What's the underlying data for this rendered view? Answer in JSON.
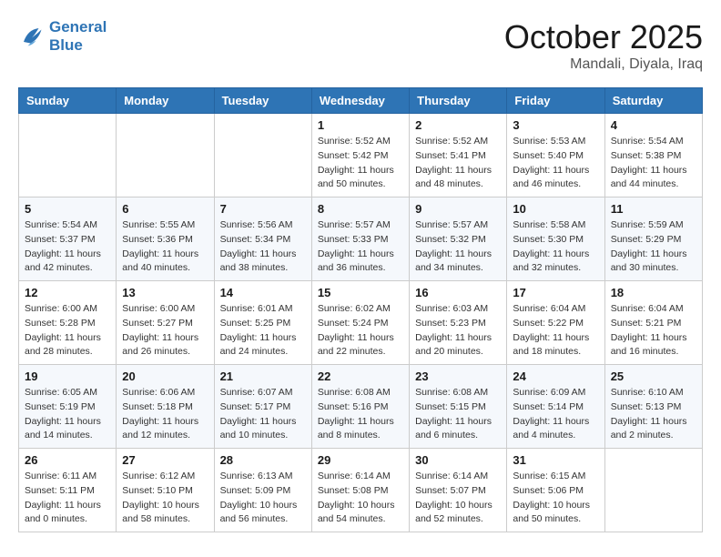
{
  "header": {
    "logo_line1": "General",
    "logo_line2": "Blue",
    "month": "October 2025",
    "location": "Mandali, Diyala, Iraq"
  },
  "weekdays": [
    "Sunday",
    "Monday",
    "Tuesday",
    "Wednesday",
    "Thursday",
    "Friday",
    "Saturday"
  ],
  "weeks": [
    [
      {
        "day": "",
        "sunrise": "",
        "sunset": "",
        "daylight": ""
      },
      {
        "day": "",
        "sunrise": "",
        "sunset": "",
        "daylight": ""
      },
      {
        "day": "",
        "sunrise": "",
        "sunset": "",
        "daylight": ""
      },
      {
        "day": "1",
        "sunrise": "Sunrise: 5:52 AM",
        "sunset": "Sunset: 5:42 PM",
        "daylight": "Daylight: 11 hours and 50 minutes."
      },
      {
        "day": "2",
        "sunrise": "Sunrise: 5:52 AM",
        "sunset": "Sunset: 5:41 PM",
        "daylight": "Daylight: 11 hours and 48 minutes."
      },
      {
        "day": "3",
        "sunrise": "Sunrise: 5:53 AM",
        "sunset": "Sunset: 5:40 PM",
        "daylight": "Daylight: 11 hours and 46 minutes."
      },
      {
        "day": "4",
        "sunrise": "Sunrise: 5:54 AM",
        "sunset": "Sunset: 5:38 PM",
        "daylight": "Daylight: 11 hours and 44 minutes."
      }
    ],
    [
      {
        "day": "5",
        "sunrise": "Sunrise: 5:54 AM",
        "sunset": "Sunset: 5:37 PM",
        "daylight": "Daylight: 11 hours and 42 minutes."
      },
      {
        "day": "6",
        "sunrise": "Sunrise: 5:55 AM",
        "sunset": "Sunset: 5:36 PM",
        "daylight": "Daylight: 11 hours and 40 minutes."
      },
      {
        "day": "7",
        "sunrise": "Sunrise: 5:56 AM",
        "sunset": "Sunset: 5:34 PM",
        "daylight": "Daylight: 11 hours and 38 minutes."
      },
      {
        "day": "8",
        "sunrise": "Sunrise: 5:57 AM",
        "sunset": "Sunset: 5:33 PM",
        "daylight": "Daylight: 11 hours and 36 minutes."
      },
      {
        "day": "9",
        "sunrise": "Sunrise: 5:57 AM",
        "sunset": "Sunset: 5:32 PM",
        "daylight": "Daylight: 11 hours and 34 minutes."
      },
      {
        "day": "10",
        "sunrise": "Sunrise: 5:58 AM",
        "sunset": "Sunset: 5:30 PM",
        "daylight": "Daylight: 11 hours and 32 minutes."
      },
      {
        "day": "11",
        "sunrise": "Sunrise: 5:59 AM",
        "sunset": "Sunset: 5:29 PM",
        "daylight": "Daylight: 11 hours and 30 minutes."
      }
    ],
    [
      {
        "day": "12",
        "sunrise": "Sunrise: 6:00 AM",
        "sunset": "Sunset: 5:28 PM",
        "daylight": "Daylight: 11 hours and 28 minutes."
      },
      {
        "day": "13",
        "sunrise": "Sunrise: 6:00 AM",
        "sunset": "Sunset: 5:27 PM",
        "daylight": "Daylight: 11 hours and 26 minutes."
      },
      {
        "day": "14",
        "sunrise": "Sunrise: 6:01 AM",
        "sunset": "Sunset: 5:25 PM",
        "daylight": "Daylight: 11 hours and 24 minutes."
      },
      {
        "day": "15",
        "sunrise": "Sunrise: 6:02 AM",
        "sunset": "Sunset: 5:24 PM",
        "daylight": "Daylight: 11 hours and 22 minutes."
      },
      {
        "day": "16",
        "sunrise": "Sunrise: 6:03 AM",
        "sunset": "Sunset: 5:23 PM",
        "daylight": "Daylight: 11 hours and 20 minutes."
      },
      {
        "day": "17",
        "sunrise": "Sunrise: 6:04 AM",
        "sunset": "Sunset: 5:22 PM",
        "daylight": "Daylight: 11 hours and 18 minutes."
      },
      {
        "day": "18",
        "sunrise": "Sunrise: 6:04 AM",
        "sunset": "Sunset: 5:21 PM",
        "daylight": "Daylight: 11 hours and 16 minutes."
      }
    ],
    [
      {
        "day": "19",
        "sunrise": "Sunrise: 6:05 AM",
        "sunset": "Sunset: 5:19 PM",
        "daylight": "Daylight: 11 hours and 14 minutes."
      },
      {
        "day": "20",
        "sunrise": "Sunrise: 6:06 AM",
        "sunset": "Sunset: 5:18 PM",
        "daylight": "Daylight: 11 hours and 12 minutes."
      },
      {
        "day": "21",
        "sunrise": "Sunrise: 6:07 AM",
        "sunset": "Sunset: 5:17 PM",
        "daylight": "Daylight: 11 hours and 10 minutes."
      },
      {
        "day": "22",
        "sunrise": "Sunrise: 6:08 AM",
        "sunset": "Sunset: 5:16 PM",
        "daylight": "Daylight: 11 hours and 8 minutes."
      },
      {
        "day": "23",
        "sunrise": "Sunrise: 6:08 AM",
        "sunset": "Sunset: 5:15 PM",
        "daylight": "Daylight: 11 hours and 6 minutes."
      },
      {
        "day": "24",
        "sunrise": "Sunrise: 6:09 AM",
        "sunset": "Sunset: 5:14 PM",
        "daylight": "Daylight: 11 hours and 4 minutes."
      },
      {
        "day": "25",
        "sunrise": "Sunrise: 6:10 AM",
        "sunset": "Sunset: 5:13 PM",
        "daylight": "Daylight: 11 hours and 2 minutes."
      }
    ],
    [
      {
        "day": "26",
        "sunrise": "Sunrise: 6:11 AM",
        "sunset": "Sunset: 5:11 PM",
        "daylight": "Daylight: 11 hours and 0 minutes."
      },
      {
        "day": "27",
        "sunrise": "Sunrise: 6:12 AM",
        "sunset": "Sunset: 5:10 PM",
        "daylight": "Daylight: 10 hours and 58 minutes."
      },
      {
        "day": "28",
        "sunrise": "Sunrise: 6:13 AM",
        "sunset": "Sunset: 5:09 PM",
        "daylight": "Daylight: 10 hours and 56 minutes."
      },
      {
        "day": "29",
        "sunrise": "Sunrise: 6:14 AM",
        "sunset": "Sunset: 5:08 PM",
        "daylight": "Daylight: 10 hours and 54 minutes."
      },
      {
        "day": "30",
        "sunrise": "Sunrise: 6:14 AM",
        "sunset": "Sunset: 5:07 PM",
        "daylight": "Daylight: 10 hours and 52 minutes."
      },
      {
        "day": "31",
        "sunrise": "Sunrise: 6:15 AM",
        "sunset": "Sunset: 5:06 PM",
        "daylight": "Daylight: 10 hours and 50 minutes."
      },
      {
        "day": "",
        "sunrise": "",
        "sunset": "",
        "daylight": ""
      }
    ]
  ]
}
